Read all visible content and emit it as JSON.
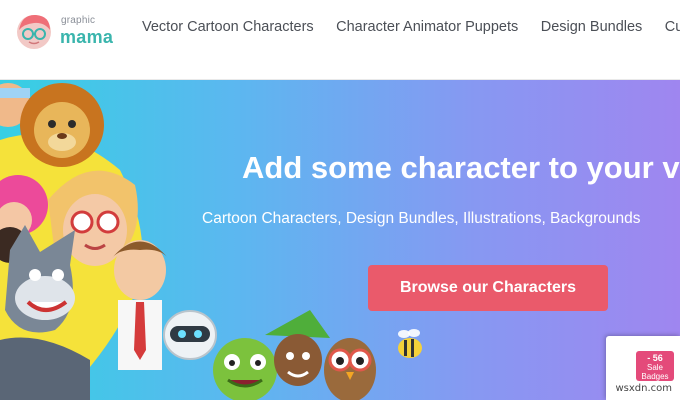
{
  "brand": {
    "small": "graphic",
    "big": "mama",
    "accent": "#3ab5ad"
  },
  "nav": {
    "items": [
      {
        "label": "Vector Cartoon Characters"
      },
      {
        "label": "Character Animator Puppets"
      },
      {
        "label": "Design Bundles"
      },
      {
        "label": "Custo"
      }
    ]
  },
  "hero": {
    "title": "Add some character to your visu",
    "subtitle": "Cartoon Characters, Design Bundles, Illustrations, Backgrounds",
    "cta": "Browse our Characters",
    "cta_color": "#ea5a6b"
  },
  "promo": {
    "line1": "- 56",
    "line2": "Sale Badges"
  },
  "watermark": "wsxdn.com"
}
